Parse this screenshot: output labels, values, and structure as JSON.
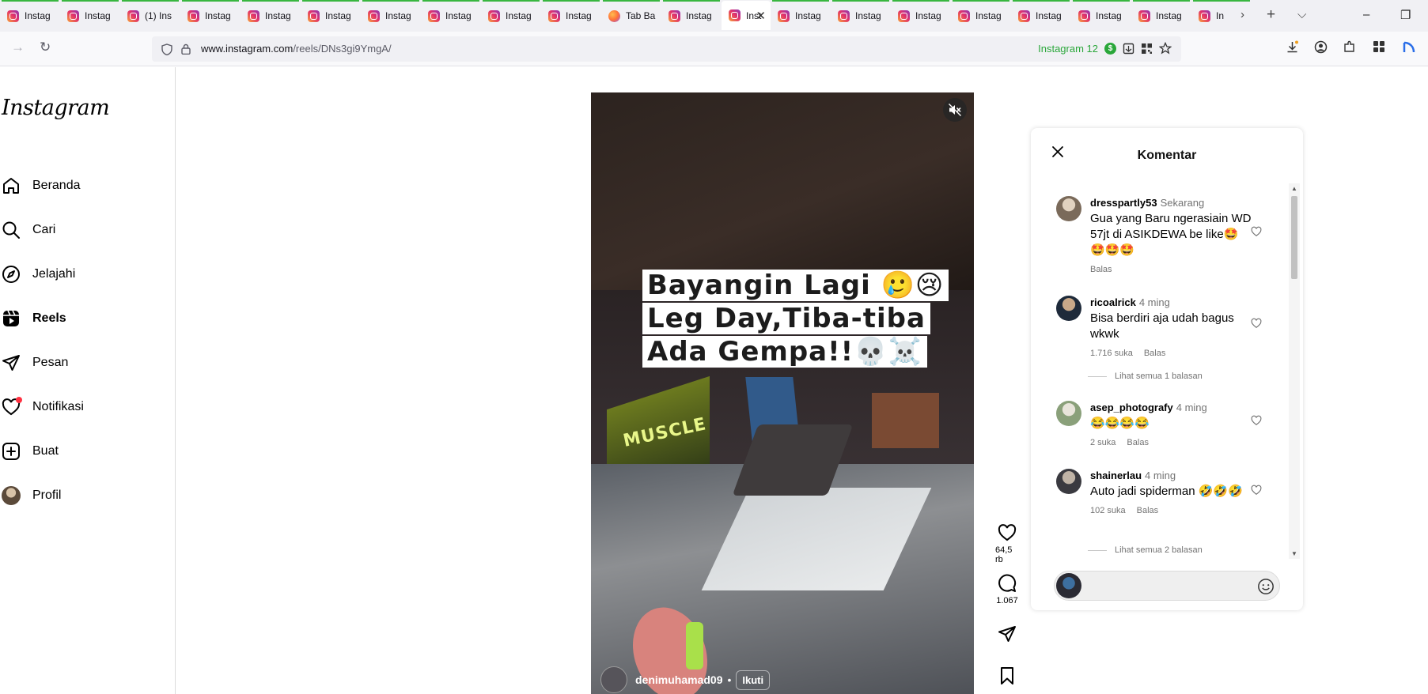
{
  "browser": {
    "tabs": [
      {
        "label": "Instag",
        "favicon": "instagram"
      },
      {
        "label": "Instag",
        "favicon": "instagram"
      },
      {
        "label": "(1) Ins",
        "favicon": "instagram"
      },
      {
        "label": "Instag",
        "favicon": "instagram"
      },
      {
        "label": "Instag",
        "favicon": "instagram"
      },
      {
        "label": "Instag",
        "favicon": "instagram"
      },
      {
        "label": "Instag",
        "favicon": "instagram"
      },
      {
        "label": "Instag",
        "favicon": "instagram"
      },
      {
        "label": "Instag",
        "favicon": "instagram"
      },
      {
        "label": "Instag",
        "favicon": "instagram"
      },
      {
        "label": "Tab Ba",
        "favicon": "firefox"
      },
      {
        "label": "Instag",
        "favicon": "instagram"
      },
      {
        "label": "Inst",
        "favicon": "instagram",
        "active": true
      },
      {
        "label": "Instag",
        "favicon": "instagram"
      },
      {
        "label": "Instag",
        "favicon": "instagram"
      },
      {
        "label": "Instag",
        "favicon": "instagram"
      },
      {
        "label": "Instag",
        "favicon": "instagram"
      },
      {
        "label": "Instag",
        "favicon": "instagram"
      },
      {
        "label": "Instag",
        "favicon": "instagram"
      },
      {
        "label": "Instag",
        "favicon": "instagram"
      },
      {
        "label": "In",
        "favicon": "instagram"
      }
    ],
    "url_host": "www.instagram.com",
    "url_path": "/reels/DNs3gi9YmgA/",
    "extension_badge": "Instagram 12",
    "extension_coin": "$"
  },
  "sidebar": {
    "logo": "Instagram",
    "items": [
      {
        "label": "Beranda",
        "icon": "home-icon"
      },
      {
        "label": "Cari",
        "icon": "search-icon"
      },
      {
        "label": "Jelajahi",
        "icon": "compass-icon"
      },
      {
        "label": "Reels",
        "icon": "reels-icon"
      },
      {
        "label": "Pesan",
        "icon": "send-icon"
      },
      {
        "label": "Notifikasi",
        "icon": "heart-icon"
      },
      {
        "label": "Buat",
        "icon": "plus-square-icon"
      },
      {
        "label": "Profil",
        "icon": "avatar"
      }
    ]
  },
  "reel": {
    "caption_lines": [
      "Bayangin Lagi 🥲😢",
      "Leg Day,Tiba-tiba",
      "Ada Gempa!!💀☠️"
    ],
    "overlay_sign": "MUSCLE",
    "owner": "denimuhamad09",
    "separator": "•",
    "follow_label": "Ikuti",
    "likes": "64,5 rb",
    "comments_count": "1.067"
  },
  "comments_panel": {
    "title": "Komentar",
    "reply_label": "Balas",
    "comments": [
      {
        "user": "dresspartly53",
        "time": "Sekarang",
        "text": "Gua yang Baru ngerasiain WD 57jt di ASIKDEWA be like🤩🤩🤩🤩",
        "likes": "",
        "reply": "Balas",
        "view_replies": ""
      },
      {
        "user": "ricoalrick",
        "time": "4 ming",
        "text": "Bisa berdiri aja udah bagus wkwk",
        "likes": "1.716 suka",
        "reply": "Balas",
        "view_replies": "Lihat semua 1 balasan"
      },
      {
        "user": "asep_photografy",
        "time": "4 ming",
        "text": "😂😂😂😂",
        "likes": "2 suka",
        "reply": "Balas",
        "view_replies": ""
      },
      {
        "user": "shainerlau",
        "time": "4 ming",
        "text": "Auto jadi spiderman 🤣🤣🤣",
        "likes": "102 suka",
        "reply": "Balas",
        "view_replies": "Lihat semua 2 balasan"
      }
    ],
    "input_placeholder": ""
  }
}
